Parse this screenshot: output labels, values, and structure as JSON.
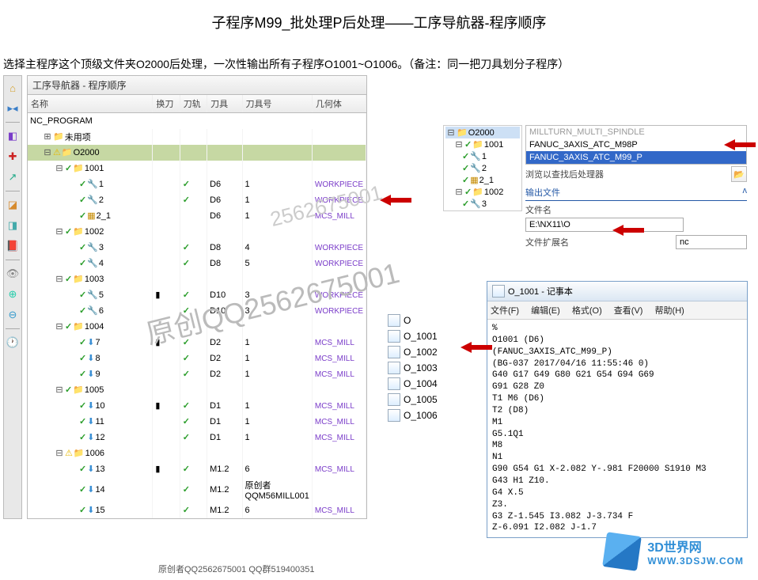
{
  "title": "子程序M99_批处理P后处理——工序导航器-程序顺序",
  "subtitle": "选择主程序这个顶级文件夹O2000后处理，一次性输出所有子程序O1001~O1006。（备注：同一把刀具划分子程序）",
  "nav_title": "工序导航器 - 程序顺序",
  "columns": {
    "name": "名称",
    "tool_change": "换刀",
    "path": "刀轨",
    "tool": "刀具",
    "toolnum": "刀具号",
    "geom": "几何体"
  },
  "root": "NC_PROGRAM",
  "rows": [
    {
      "ind": 1,
      "tog": "+",
      "ic": "folder",
      "name": "未用项"
    },
    {
      "ind": 1,
      "tog": "-",
      "warn": true,
      "ic": "folder",
      "name": "O2000",
      "sel": true
    },
    {
      "ind": 2,
      "tog": "-",
      "chk": true,
      "ic": "folder",
      "name": "1001"
    },
    {
      "ind": 3,
      "chk": true,
      "ic": "op",
      "name": "1",
      "path": "✓",
      "tool": "D6",
      "num": "1",
      "geom": "WORKPIECE"
    },
    {
      "ind": 3,
      "chk": true,
      "ic": "op",
      "name": "2",
      "path": "✓",
      "tool": "D6",
      "num": "1",
      "geom": "WORKPIECE"
    },
    {
      "ind": 3,
      "chk": true,
      "ic": "mcs",
      "name": "2_1",
      "tool": "D6",
      "num": "1",
      "geom": "MCS_MILL"
    },
    {
      "ind": 2,
      "tog": "-",
      "chk": true,
      "ic": "folder",
      "name": "1002"
    },
    {
      "ind": 3,
      "chk": true,
      "ic": "op",
      "name": "3",
      "path": "✓",
      "tool": "D8",
      "num": "4",
      "geom": "WORKPIECE"
    },
    {
      "ind": 3,
      "chk": true,
      "ic": "op",
      "name": "4",
      "path": "✓",
      "tool": "D8",
      "num": "5",
      "geom": "WORKPIECE"
    },
    {
      "ind": 2,
      "tog": "-",
      "chk": true,
      "ic": "folder",
      "name": "1003"
    },
    {
      "ind": 3,
      "chk": true,
      "ic": "op",
      "name": "5",
      "tc": "▮",
      "path": "✓",
      "tool": "D10",
      "num": "3",
      "geom": "WORKPIECE"
    },
    {
      "ind": 3,
      "chk": true,
      "ic": "op",
      "name": "6",
      "path": "✓",
      "tool": "D10",
      "num": "3",
      "geom": "WORKPIECE"
    },
    {
      "ind": 2,
      "tog": "-",
      "chk": true,
      "ic": "folder",
      "name": "1004"
    },
    {
      "ind": 3,
      "chk": true,
      "ic": "op2",
      "name": "7",
      "tc": "▮",
      "path": "✓",
      "tool": "D2",
      "num": "1",
      "geom": "MCS_MILL"
    },
    {
      "ind": 3,
      "chk": true,
      "ic": "op2",
      "name": "8",
      "path": "✓",
      "tool": "D2",
      "num": "1",
      "geom": "MCS_MILL"
    },
    {
      "ind": 3,
      "chk": true,
      "ic": "op2",
      "name": "9",
      "path": "✓",
      "tool": "D2",
      "num": "1",
      "geom": "MCS_MILL"
    },
    {
      "ind": 2,
      "tog": "-",
      "chk": true,
      "ic": "folder",
      "name": "1005"
    },
    {
      "ind": 3,
      "chk": true,
      "ic": "op2",
      "name": "10",
      "tc": "▮",
      "path": "✓",
      "tool": "D1",
      "num": "1",
      "geom": "MCS_MILL"
    },
    {
      "ind": 3,
      "chk": true,
      "ic": "op2",
      "name": "11",
      "path": "✓",
      "tool": "D1",
      "num": "1",
      "geom": "MCS_MILL"
    },
    {
      "ind": 3,
      "chk": true,
      "ic": "op2",
      "name": "12",
      "path": "✓",
      "tool": "D1",
      "num": "1",
      "geom": "MCS_MILL"
    },
    {
      "ind": 2,
      "tog": "-",
      "warn": true,
      "ic": "folder",
      "name": "1006"
    },
    {
      "ind": 3,
      "chk": true,
      "ic": "op2",
      "name": "13",
      "tc": "▮",
      "path": "✓",
      "tool": "M1.2",
      "num": "6",
      "geom": "MCS_MILL"
    },
    {
      "ind": 3,
      "chk": true,
      "ic": "op2",
      "name": "14",
      "path": "✓",
      "tool": "M1.2",
      "num": "原创者QQM56MILL001",
      "geom": ""
    },
    {
      "ind": 3,
      "chk": true,
      "ic": "op2",
      "name": "15",
      "path": "✓",
      "tool": "M1.2",
      "num": "6",
      "geom": "MCS_MILL"
    }
  ],
  "mini_tree": [
    {
      "ind": 0,
      "tog": "-",
      "ic": "folder",
      "name": "O2000",
      "sel": true
    },
    {
      "ind": 1,
      "tog": "-",
      "chk": true,
      "ic": "folder",
      "name": "1001"
    },
    {
      "ind": 2,
      "chk": true,
      "ic": "op",
      "name": "1"
    },
    {
      "ind": 2,
      "chk": true,
      "ic": "op",
      "name": "2"
    },
    {
      "ind": 2,
      "chk": true,
      "ic": "mcs",
      "name": "2_1"
    },
    {
      "ind": 1,
      "tog": "-",
      "chk": true,
      "ic": "folder",
      "name": "1002"
    },
    {
      "ind": 2,
      "chk": true,
      "ic": "op",
      "name": "3"
    }
  ],
  "post": {
    "p1": "MILLTURN_MULTI_SPINDLE",
    "p2": "FANUC_3AXIS_ATC_M98P",
    "p3": "FANUC_3AXIS_ATC_M99_P",
    "browse_lbl": "浏览以查找后处理器",
    "out_section": "输出文件",
    "fname_lbl": "文件名",
    "fname_val": "E:\\NX11\\O",
    "ext_lbl": "文件扩展名",
    "ext_val": "nc"
  },
  "files": [
    "O",
    "O_1001",
    "O_1002",
    "O_1003",
    "O_1004",
    "O_1005",
    "O_1006"
  ],
  "notepad": {
    "title": "O_1001 - 记事本",
    "menu": {
      "file": "文件(F)",
      "edit": "编辑(E)",
      "format": "格式(O)",
      "view": "查看(V)",
      "help": "帮助(H)"
    },
    "body": "%\nO1001 (D6)\n(FANUC_3AXIS_ATC_M99_P)\n(BG-037 2017/04/16 11:55:46 0)\nG40 G17 G49 G80 G21 G54 G94 G69\nG91 G28 Z0\nT1 M6 (D6)\nT2 (D8)\nM1\nG5.1Q1\nM8\nN1\nG90 G54 G1 X-2.082 Y-.981 F20000 S1910 M3\nG43 H1 Z10.\nG4 X.5\nZ3.\nG3 Z-1.545 I3.082 J-3.734 F\nZ-6.091 I2.082 J-1.7"
  },
  "watermark1": "原创QQ2562675001",
  "watermark2": "2562675001",
  "footer": "原创者QQ2562675001    QQ群519400351",
  "logo": {
    "t1": "3D世界网",
    "t2": "WWW.3DSJW.COM"
  }
}
